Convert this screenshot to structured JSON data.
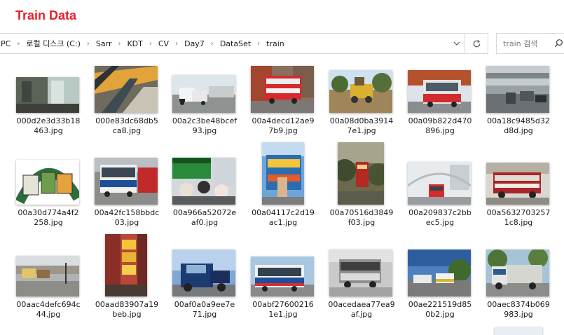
{
  "title": "Train Data",
  "address": {
    "crumbs": [
      "PC",
      "로컬 디스크 (C:)",
      "Sarr",
      "KDT",
      "CV",
      "Day7",
      "DataSet",
      "train"
    ]
  },
  "search": {
    "placeholder": "train 검색"
  },
  "icons": {
    "chevron": "chevron-right-icon",
    "dropdown": "chevron-down-icon",
    "refresh": "refresh-icon",
    "search": "search-icon"
  },
  "files": [
    {
      "line1": "000d2e3d33b18",
      "line2": "463.jpg"
    },
    {
      "line1": "000e83dc68db5",
      "line2": "ca8.jpg"
    },
    {
      "line1": "00a2c3be48bcef",
      "line2": "93.jpg"
    },
    {
      "line1": "00a4decd12ae9",
      "line2": "7b9.jpg"
    },
    {
      "line1": "00a08d0ba3914",
      "line2": "7e1.jpg"
    },
    {
      "line1": "00a09b822d470",
      "line2": "896.jpg"
    },
    {
      "line1": "00a18c9485d32",
      "line2": "d8d.jpg"
    },
    {
      "line1": "00a30d774a4f2",
      "line2": "258.jpg"
    },
    {
      "line1": "00a42fc158bbdc",
      "line2": "03.jpg"
    },
    {
      "line1": "00a966a52072e",
      "line2": "af0.jpg"
    },
    {
      "line1": "00a04117c2d19",
      "line2": "ac1.jpg"
    },
    {
      "line1": "00a70516d3849",
      "line2": "f03.jpg"
    },
    {
      "line1": "00a209837c2bb",
      "line2": "ec5.jpg"
    },
    {
      "line1": "00a5632703257",
      "line2": "1c8.jpg"
    },
    {
      "line1": "00aac4defc694c",
      "line2": "44.jpg"
    },
    {
      "line1": "00aad83907a19",
      "line2": "beb.jpg"
    },
    {
      "line1": "00af0a0a9ee7e",
      "line2": "71.jpg"
    },
    {
      "line1": "00abf27600216",
      "line2": "1e1.jpg"
    },
    {
      "line1": "00acedaea77ea9",
      "line2": "af.jpg"
    },
    {
      "line1": "00ae221519d85",
      "line2": "0b2.jpg"
    },
    {
      "line1": "00aec8374b069",
      "line2": "983.jpg"
    }
  ]
}
